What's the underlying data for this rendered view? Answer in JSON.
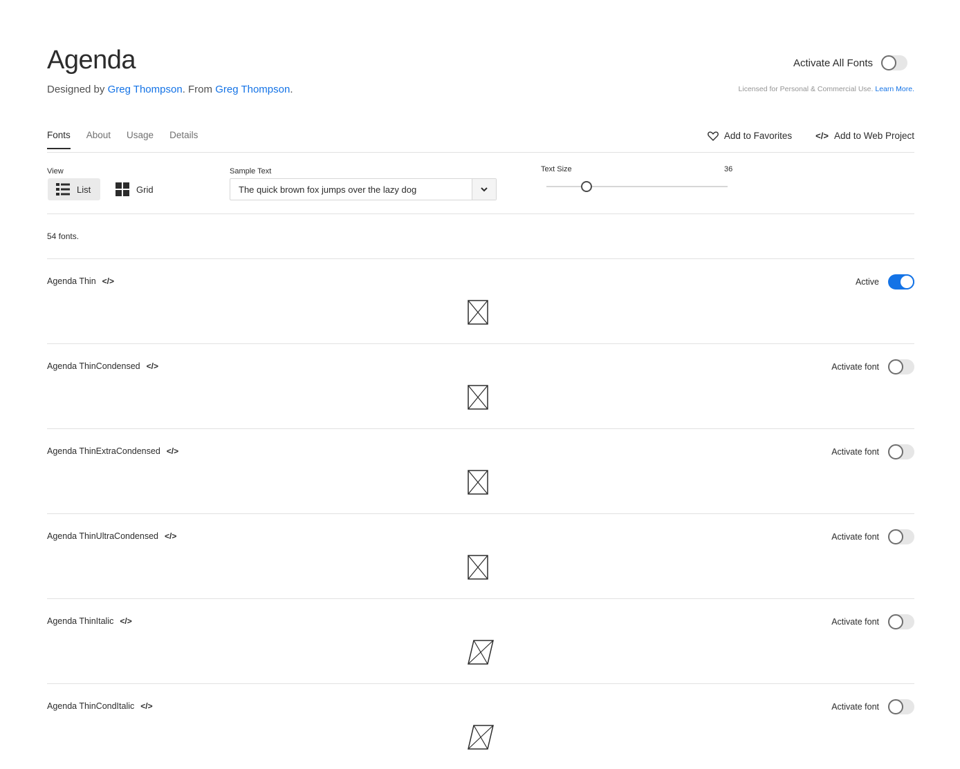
{
  "header": {
    "title": "Agenda",
    "byline_prefix": "Designed by",
    "designer": "Greg Thompson",
    "byline_mid": ". From",
    "foundry": "Greg Thompson",
    "byline_end": ".",
    "activate_all_label": "Activate All Fonts",
    "license_text": "Licensed for Personal & Commercial Use.",
    "learn_more": "Learn More."
  },
  "tabs": [
    {
      "label": "Fonts",
      "active": true
    },
    {
      "label": "About",
      "active": false
    },
    {
      "label": "Usage",
      "active": false
    },
    {
      "label": "Details",
      "active": false
    }
  ],
  "actions": {
    "favorites": "Add to Favorites",
    "web_project": "Add to Web Project"
  },
  "controls": {
    "view_label": "View",
    "list_label": "List",
    "grid_label": "Grid",
    "sample_label": "Sample Text",
    "sample_value": "The quick brown fox jumps over the lazy dog",
    "size_label": "Text Size",
    "size_value": "36"
  },
  "font_count": "54 fonts.",
  "fonts": [
    {
      "name": "Agenda Thin",
      "status": "Active",
      "active": true,
      "italic": false
    },
    {
      "name": "Agenda ThinCondensed",
      "status": "Activate font",
      "active": false,
      "italic": false
    },
    {
      "name": "Agenda ThinExtraCondensed",
      "status": "Activate font",
      "active": false,
      "italic": false
    },
    {
      "name": "Agenda ThinUltraCondensed",
      "status": "Activate font",
      "active": false,
      "italic": false
    },
    {
      "name": "Agenda ThinItalic",
      "status": "Activate font",
      "active": false,
      "italic": true
    },
    {
      "name": "Agenda ThinCondItalic",
      "status": "Activate font",
      "active": false,
      "italic": true
    }
  ],
  "code_glyph": "</>",
  "colors": {
    "accent": "#1473e6",
    "text": "#2c2c2c",
    "divider": "#e1e1e1"
  }
}
